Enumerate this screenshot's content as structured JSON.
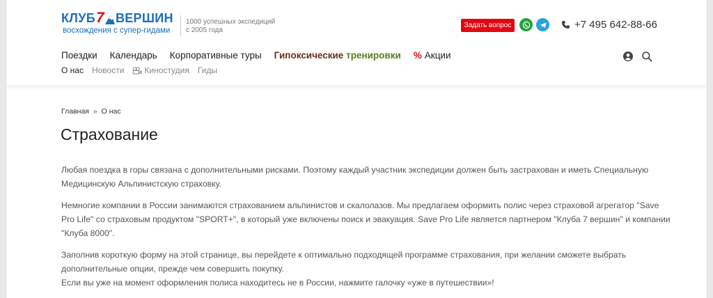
{
  "header": {
    "logo": {
      "club": "КЛУБ",
      "seven": "7",
      "peaks": "ВЕРШИН",
      "subtitle": "восхождения с супер-гидами"
    },
    "tagline": "1000 успешных экспедиций с 2005 года",
    "ask_button": "Задать вопрос",
    "phone": "+7 495 642-88-66",
    "brand_color": "#1d6fb8",
    "accent_color": "#e30613"
  },
  "nav": {
    "items": [
      {
        "label": "Поездки"
      },
      {
        "label": "Календарь"
      },
      {
        "label": "Корпоративные туры"
      }
    ],
    "hypoxic": {
      "word1": "Гипоксические",
      "word2": "тренировки"
    },
    "promo": {
      "pct": "%",
      "label": "Акции"
    }
  },
  "subnav": {
    "items": [
      "О нас",
      "Новости",
      "Киностудия",
      "Гиды"
    ]
  },
  "breadcrumb": {
    "home": "Главная",
    "sep": "»",
    "current": "О нас"
  },
  "page": {
    "title": "Страхование",
    "paragraphs": [
      "Любая поездка в горы связана с дополнительными рисками. Поэтому каждый участник экспедиции должен быть застрахован и иметь Специальную Медицинскую Альпинистскую страховку.",
      "Немногие компании в России занимаются страхованием альпинистов и скалолазов. Мы предлагаем оформить полис через страховой агрегатор \"Save Pro Life\" со страховым продуктом \"SPORT+\", в который уже включены поиск и эвакуация. Save Pro Life является партнером \"Клуба 7 вершин\" и компании \"Клуба 8000\".",
      "Заполнив короткую форму на этой странице, вы перейдете к оптимально подходящей программе страхования, при желании сможете выбрать дополнительные опции, прежде чем совершить покупку."
    ],
    "last_line": "Если вы уже на момент оформления полиса находитесь не в России, нажмите галочку «уже в путешествии»!"
  },
  "icons": {
    "whatsapp": "whatsapp-icon",
    "telegram": "telegram-icon",
    "phone": "phone-icon",
    "user": "user-icon",
    "search": "search-icon",
    "camera": "camera-icon"
  }
}
